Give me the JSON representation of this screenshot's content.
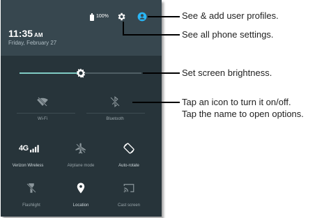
{
  "status_bar": {
    "battery_text": "100%",
    "time": "11:35",
    "ampm": "AM",
    "date": "Friday, February 27"
  },
  "quick_settings": {
    "brightness_level": 0.5,
    "tiles": [
      {
        "label": "Wi-Fi",
        "icon": "wifi-off-icon",
        "active": false
      },
      {
        "label": "Bluetooth",
        "icon": "bluetooth-off-icon",
        "active": false
      },
      {
        "label": "Verizon Wireless",
        "icon": "4g-signal-icon",
        "active": true
      },
      {
        "label": "Airplane mode",
        "icon": "airplane-icon",
        "active": false
      },
      {
        "label": "Auto-rotate",
        "icon": "auto-rotate-icon",
        "active": true
      },
      {
        "label": "Flashlight",
        "icon": "flashlight-icon",
        "active": false
      },
      {
        "label": "Location",
        "icon": "location-pin-icon",
        "active": true
      },
      {
        "label": "Cast screen",
        "icon": "cast-icon",
        "active": false
      }
    ],
    "network_badge": "4G"
  },
  "callouts": {
    "user_profiles": "See & add user profiles.",
    "phone_settings": "See all phone settings.",
    "brightness": "Set screen brightness.",
    "icon_tap_line1": "Tap an icon to turn it on/off.",
    "icon_tap_line2": "Tap the name to open options."
  },
  "colors": {
    "accent": "#80cbc4",
    "avatar": "#29b6f6",
    "header_bg": "#37474f",
    "panel_bg": "#27343a"
  }
}
